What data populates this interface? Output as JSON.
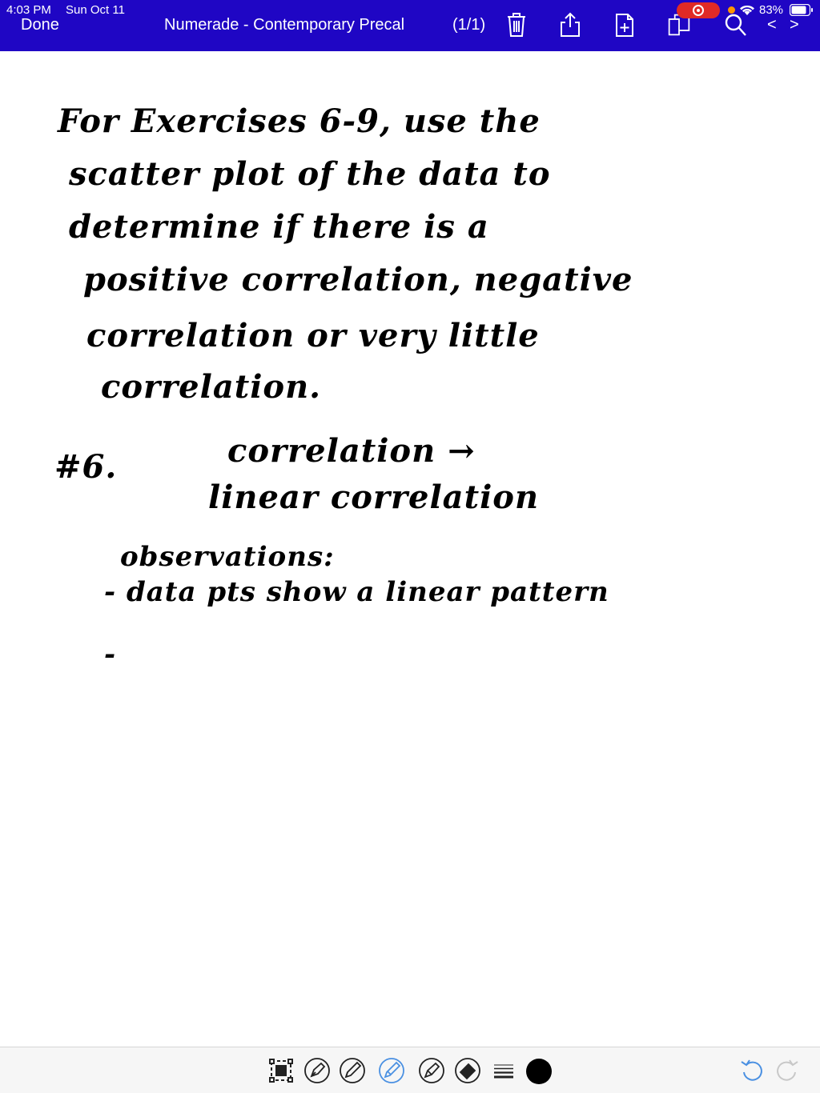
{
  "status_bar": {
    "time": "4:03 PM",
    "date": "Sun Oct 11",
    "battery": "83%"
  },
  "toolbar": {
    "done_label": "Done",
    "title": "Numerade - Contemporary Precal",
    "page_count": "(1/1)",
    "prev_label": "<",
    "next_label": ">",
    "icons": [
      "trash-icon",
      "share-icon",
      "add-page-icon",
      "pages-icon",
      "search-icon"
    ]
  },
  "note": {
    "lines": [
      "For Exercises 6-9, use the",
      "scatter plot of the data to",
      "determine if there is a",
      "positive correlation, negative",
      "correlation or very little",
      "correlation.",
      "#6.",
      "correlation →",
      "linear correlation",
      "observations:",
      "- data pts show a linear pattern",
      "-"
    ]
  },
  "bottom_tools": {
    "tools": [
      "lasso-icon",
      "pen-icon",
      "pencil-icon",
      "highlighter-icon",
      "marker-icon",
      "eraser-icon",
      "line-width-icon"
    ],
    "selected_tool": "highlighter-icon",
    "active_color": "#000000",
    "undo": "undo-icon",
    "redo": "redo-icon"
  },
  "colors": {
    "nav_bar": "#1f06c4",
    "accent": "#4a90e2",
    "record": "#e02a26"
  }
}
